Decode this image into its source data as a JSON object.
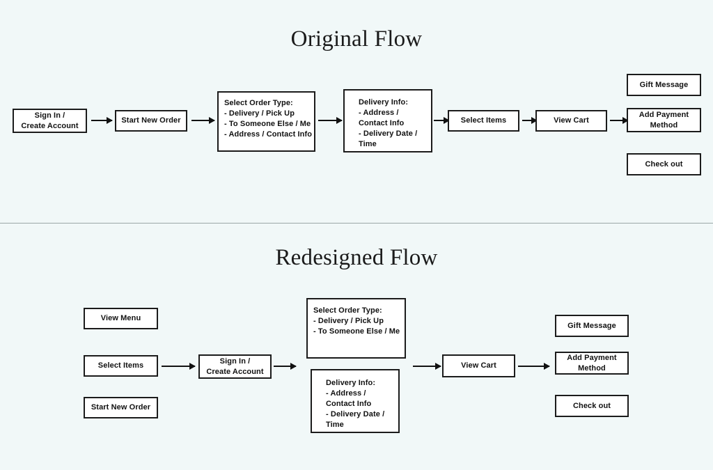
{
  "page": {
    "background_color": "#f1f8f8",
    "node_fill": "#ffffff",
    "node_border_color": "#1b1b1b",
    "text_color": "#111111"
  },
  "original_flow": {
    "title": "Original Flow",
    "nodes": {
      "sign_in": {
        "line1": "Sign In /",
        "line2": "Create Account"
      },
      "start_new_order": {
        "line1": "Start New Order"
      },
      "select_order_type": {
        "line1": "Select Order Type:",
        "line2": "- Delivery / Pick Up",
        "line3": "- To Someone Else / Me",
        "line4": "- Address / Contact Info"
      },
      "delivery_info": {
        "line1": "Delivery Info:",
        "line2": "- Address /",
        "line3": "Contact Info",
        "line4": "- Delivery Date /",
        "line5": "Time"
      },
      "select_items": {
        "line1": "Select Items"
      },
      "view_cart": {
        "line1": "View Cart"
      },
      "gift_message": {
        "line1": "Gift Message"
      },
      "add_payment_method": {
        "line1": "Add Payment",
        "line2": "Method"
      },
      "check_out": {
        "line1": "Check out"
      }
    }
  },
  "redesigned_flow": {
    "title": "Redesigned Flow",
    "nodes": {
      "view_menu": {
        "line1": "View Menu"
      },
      "select_items": {
        "line1": "Select Items"
      },
      "start_new_order": {
        "line1": "Start New Order"
      },
      "sign_in": {
        "line1": "Sign In /",
        "line2": "Create Account"
      },
      "select_order_type": {
        "line1": "Select Order Type:",
        "line2": "- Delivery / Pick Up",
        "line3": "- To Someone Else / Me"
      },
      "delivery_info": {
        "line1": "Delivery Info:",
        "line2": "- Address /",
        "line3": "Contact Info",
        "line4": "- Delivery Date /",
        "line5": "Time"
      },
      "view_cart": {
        "line1": "View Cart"
      },
      "gift_message": {
        "line1": "Gift Message"
      },
      "add_payment_method": {
        "line1": "Add Payment",
        "line2": "Method"
      },
      "check_out": {
        "line1": "Check out"
      }
    }
  }
}
